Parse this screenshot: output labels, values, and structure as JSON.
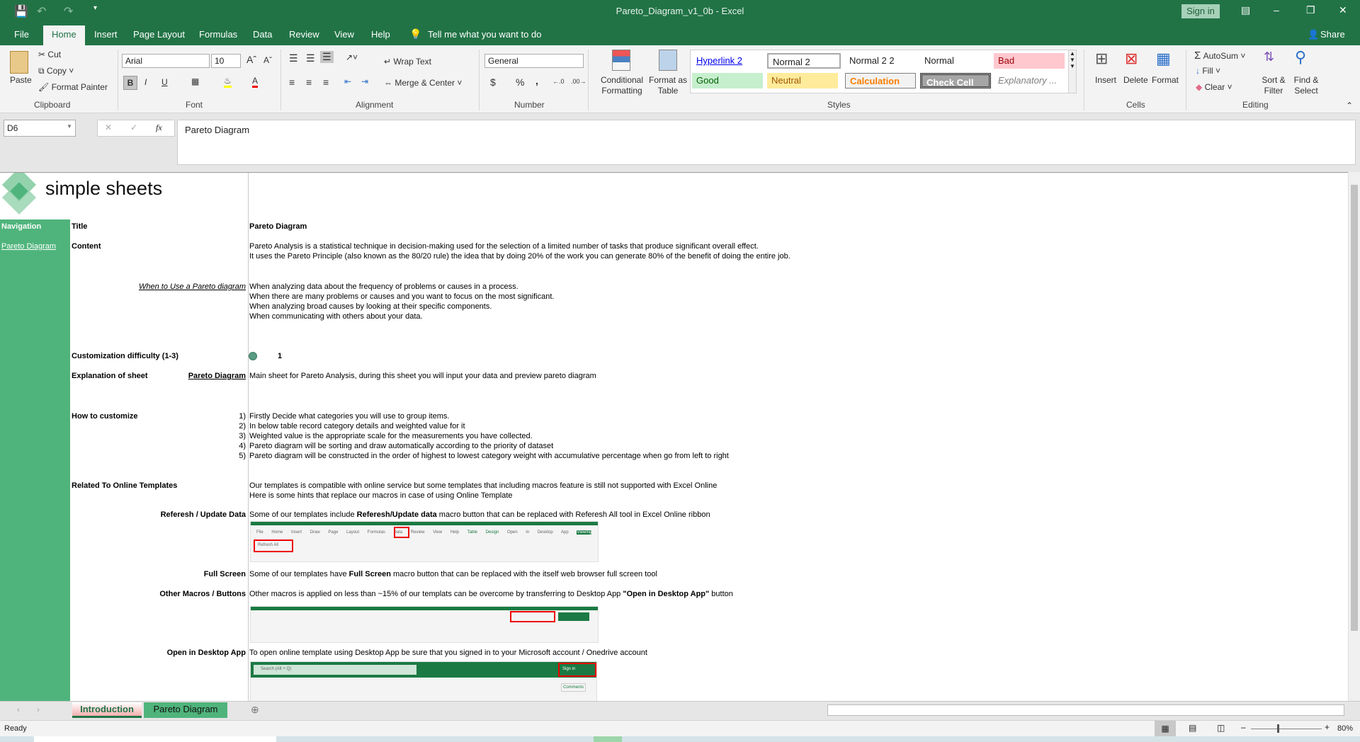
{
  "window": {
    "title": "Pareto_Diagram_v1_0b  -  Excel",
    "sign_in": "Sign in",
    "share": "Share"
  },
  "menu_tabs": [
    "File",
    "Home",
    "Insert",
    "Page Layout",
    "Formulas",
    "Data",
    "Review",
    "View",
    "Help"
  ],
  "tell_me": "Tell me what you want to do",
  "ribbon": {
    "clipboard": {
      "paste": "Paste",
      "cut": "Cut",
      "copy": "Copy",
      "format_painter": "Format Painter",
      "label": "Clipboard"
    },
    "font": {
      "name": "Arial",
      "size": "10",
      "label": "Font",
      "bold": "B",
      "italic": "I",
      "underline": "U"
    },
    "alignment": {
      "wrap_text": "Wrap Text",
      "merge_center": "Merge & Center",
      "label": "Alignment"
    },
    "number": {
      "format": "General",
      "label": "Number",
      "currency": "$",
      "percent": "%",
      "comma": ","
    },
    "styles": {
      "conditional": "Conditional Formatting",
      "format_table": "Format as Table",
      "label": "Styles",
      "cells": [
        "Hyperlink 2",
        "Normal 2",
        "Normal 2 2",
        "Normal",
        "Bad",
        "Good",
        "Neutral",
        "Calculation",
        "Check Cell",
        "Explanatory ..."
      ]
    },
    "cells": {
      "insert": "Insert",
      "delete": "Delete",
      "format": "Format",
      "label": "Cells"
    },
    "editing": {
      "autosum": "AutoSum",
      "fill": "Fill",
      "clear": "Clear",
      "sort_filter": "Sort & Filter",
      "find_select": "Find & Select",
      "label": "Editing"
    }
  },
  "formula_bar": {
    "name_box": "D6",
    "fx": "fx",
    "value": "Pareto Diagram"
  },
  "sheet": {
    "logo_text": "simple sheets",
    "navigation": "Navigation",
    "nav_link": "Pareto Diagram",
    "title_label": "Title",
    "title_value": "Pareto Diagram",
    "content_label": "Content",
    "content": [
      "Pareto Analysis is a statistical technique in decision-making used for the selection of a limited number of tasks that produce significant overall effect.",
      "It uses the Pareto Principle (also known as the 80/20 rule) the idea that by doing 20% of the work you can generate 80% of the benefit of doing the entire job."
    ],
    "when_label": "When to Use a Pareto diagram",
    "when": [
      "When analyzing data about the frequency of problems or causes in a process.",
      "When there are many problems or causes and you want to focus on the most significant.",
      "When analyzing broad causes by looking at their specific components.",
      "When communicating with others about your data."
    ],
    "difficulty_label": "Customization difficulty (1-3)",
    "difficulty_value": "1",
    "explanation_label": "Explanation of sheet",
    "explanation_link": "Pareto Diagram",
    "explanation_text": "Main sheet for Pareto Analysis, during this sheet you will input your data and preview pareto diagram",
    "customize_label": "How to customize",
    "customize_steps": [
      {
        "n": "1)",
        "text": "Firstly Decide what categories you will use to group items."
      },
      {
        "n": "2)",
        "text": "In below table record category details and weighted value for it"
      },
      {
        "n": "3)",
        "text": "Weighted value is the appropriate scale for the measurements you have collected."
      },
      {
        "n": "4)",
        "text": "Pareto diagram will be sorting and draw automatically according to the priority of dataset"
      },
      {
        "n": "5)",
        "text": "Pareto diagram will be constructed in the order of  highest to lowest category weight with accumulative percentage when go from left to right"
      }
    ],
    "online_label": "Related To Online Templates",
    "online": [
      "Our templates is compatible with online service but some templates that including macros feature is still not supported with Excel Online",
      "Here is some hints that replace our macros in case of using Online Template"
    ],
    "refresh_label": "Referesh / Update Data",
    "refresh_pre": "Some of our templates include ",
    "refresh_bold": "Referesh/Update data",
    "refresh_post": " macro button that can be replaced with Referesh All tool in Excel Online ribbon",
    "full_label": "Full Screen",
    "full_pre": "Some of our templates have ",
    "full_bold": "Full Screen",
    "full_post": " macro button that can be replaced with the itself web browser full screen tool",
    "other_label": "Other Macros / Buttons",
    "other_pre": "Other macros is applied on less than ~15% of our templats can be overcome by transferring to Desktop App ",
    "other_bold": "\"Open in Desktop App\"",
    "other_post": " button",
    "open_label": "Open in Desktop App",
    "open_text": "To open online template using Desktop App be sure that you signed in to your Microsoft account / Onedrive account",
    "shot_tabs": [
      "File",
      "Home",
      "Insert",
      "Draw",
      "Page Layout",
      "Formulas",
      "Data",
      "Review",
      "View",
      "Help",
      "Table Design",
      "Open in Desktop App",
      "Viewing"
    ],
    "shot_refresh": "Refresh All",
    "shot_search": "Search (Alt + Q)",
    "shot_signin": "Sign in",
    "shot_comments": "Comments"
  },
  "sheet_tabs": [
    "Introduction",
    "Pareto Diagram"
  ],
  "status": {
    "ready": "Ready",
    "zoom": "80%"
  },
  "colors": {
    "excel_green": "#217346",
    "sheet_green": "#4fb47b"
  }
}
